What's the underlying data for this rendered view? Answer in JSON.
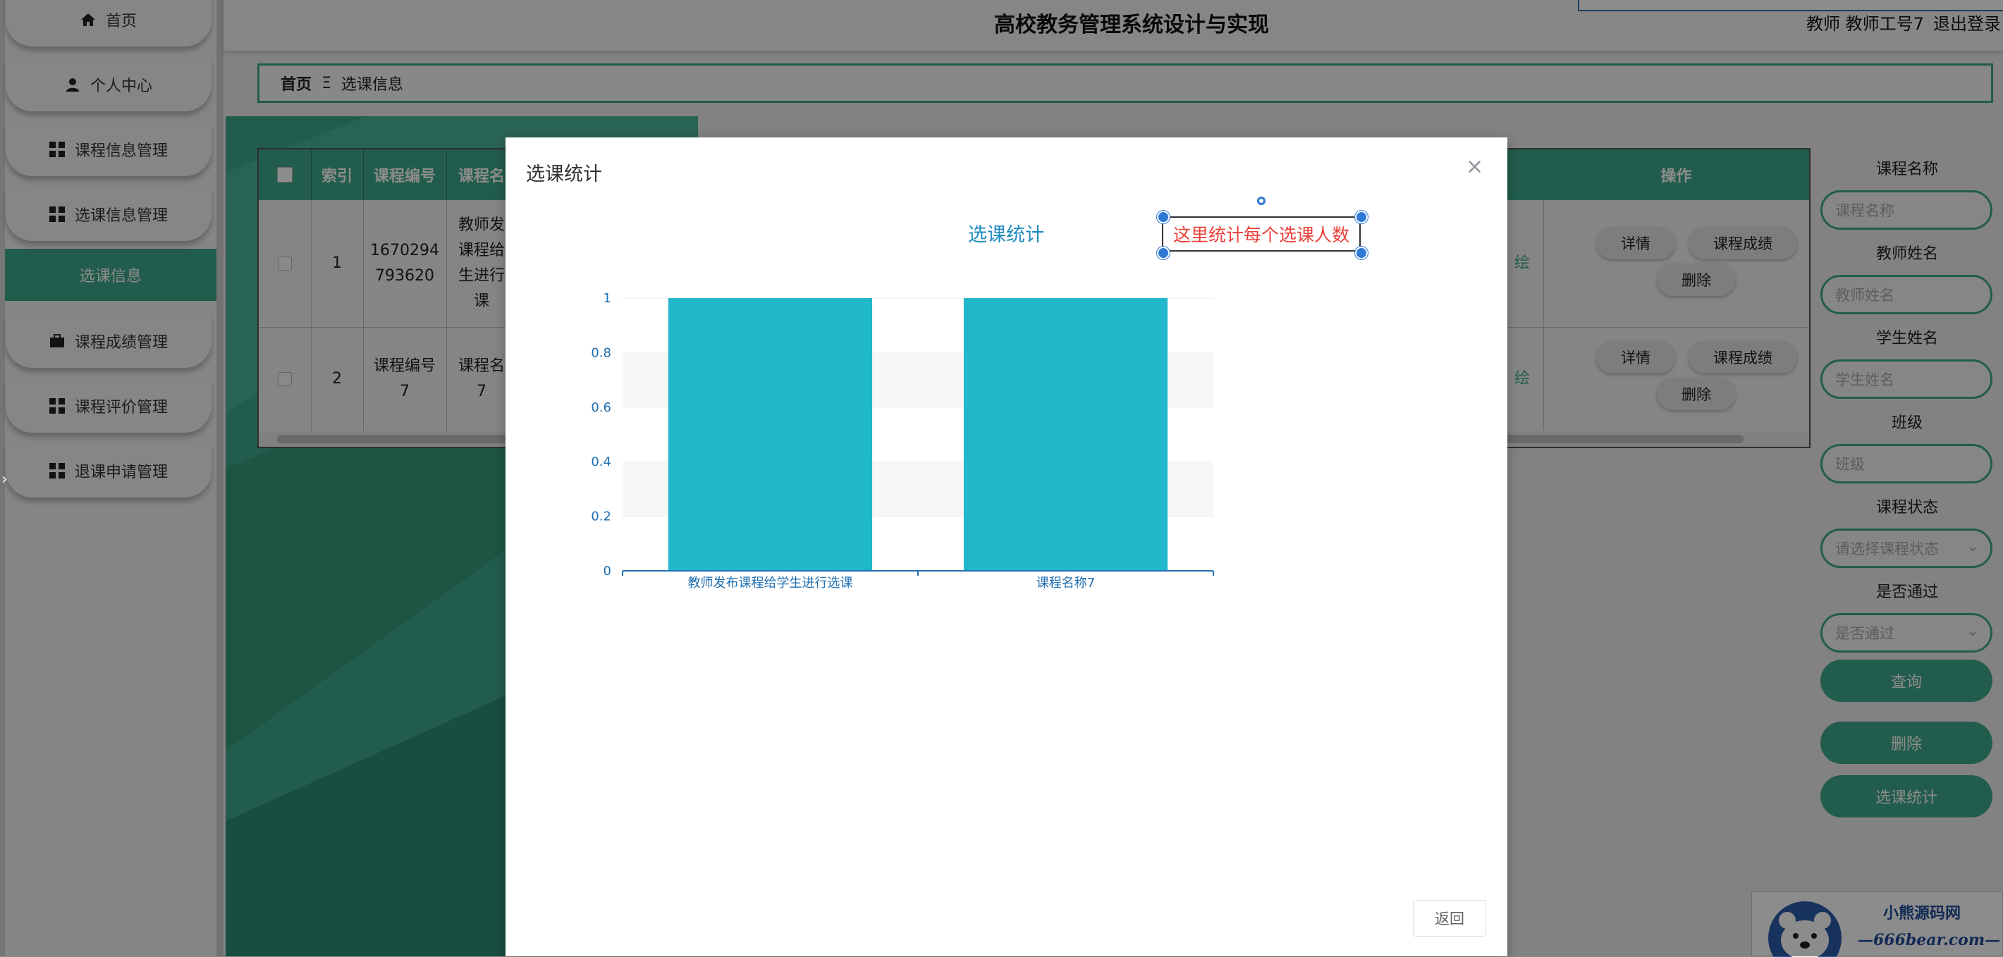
{
  "app": {
    "title": "高校教务管理系统设计与实现",
    "user_info": "教师 教师工号7",
    "logout": "退出登录"
  },
  "sidebar": {
    "items": [
      {
        "label": "首页",
        "icon": "home-icon"
      },
      {
        "label": "个人中心",
        "icon": "user-icon"
      },
      {
        "label": "课程信息管理",
        "icon": "grid-icon"
      },
      {
        "label": "选课信息管理",
        "icon": "grid-icon"
      },
      {
        "label": "课程成绩管理",
        "icon": "briefcase-icon"
      },
      {
        "label": "课程评价管理",
        "icon": "grid-icon"
      },
      {
        "label": "退课申请管理",
        "icon": "grid-icon"
      }
    ],
    "active_sub": "选课信息"
  },
  "breadcrumb": {
    "home": "首页",
    "separator": "Ξ",
    "current": "选课信息"
  },
  "table": {
    "headers": [
      "索引",
      "课程编号",
      "课程名",
      "操作"
    ],
    "rows": [
      {
        "index": "1",
        "course_no": "1670294\n793620",
        "course_name": "教师发\n课程给\n生进行\n课"
      },
      {
        "index": "2",
        "course_no": "课程编号\n7",
        "course_name": "课程名\n7"
      }
    ],
    "actions": {
      "detail": "详情",
      "score": "课程成绩",
      "delete": "删除"
    },
    "cut_text": "绘"
  },
  "search": {
    "course_name": {
      "label": "课程名称",
      "placeholder": "课程名称"
    },
    "teacher_name": {
      "label": "教师姓名",
      "placeholder": "教师姓名"
    },
    "student_name": {
      "label": "学生姓名",
      "placeholder": "学生姓名"
    },
    "class": {
      "label": "班级",
      "placeholder": "班级"
    },
    "course_status": {
      "label": "课程状态",
      "placeholder": "请选择课程状态"
    },
    "passed": {
      "label": "是否通过",
      "placeholder": "是否通过"
    },
    "query_button": "查询",
    "delete_button": "删除",
    "stats_button": "选课统计"
  },
  "watermark": {
    "title": "小熊源码网",
    "url": "—666bear.com—"
  },
  "modal": {
    "title": "选课统计",
    "close": "×",
    "return_button": "返回",
    "annotation": "这里统计每个选课人数"
  },
  "chart_data": {
    "type": "bar",
    "title": "选课统计",
    "categories": [
      "教师发布课程给学生进行选课",
      "课程名称7"
    ],
    "values": [
      1,
      1
    ],
    "ylim": [
      0,
      1
    ],
    "yticks": [
      "0",
      "0.2",
      "0.4",
      "0.6",
      "0.8",
      "1"
    ],
    "xlabel": "",
    "ylabel": "",
    "bar_color": "#22b8cb",
    "axis_color": "#1f6fb2",
    "legend": "none"
  },
  "colors": {
    "accent": "#3ea88a",
    "annotation": "#e8413b"
  }
}
